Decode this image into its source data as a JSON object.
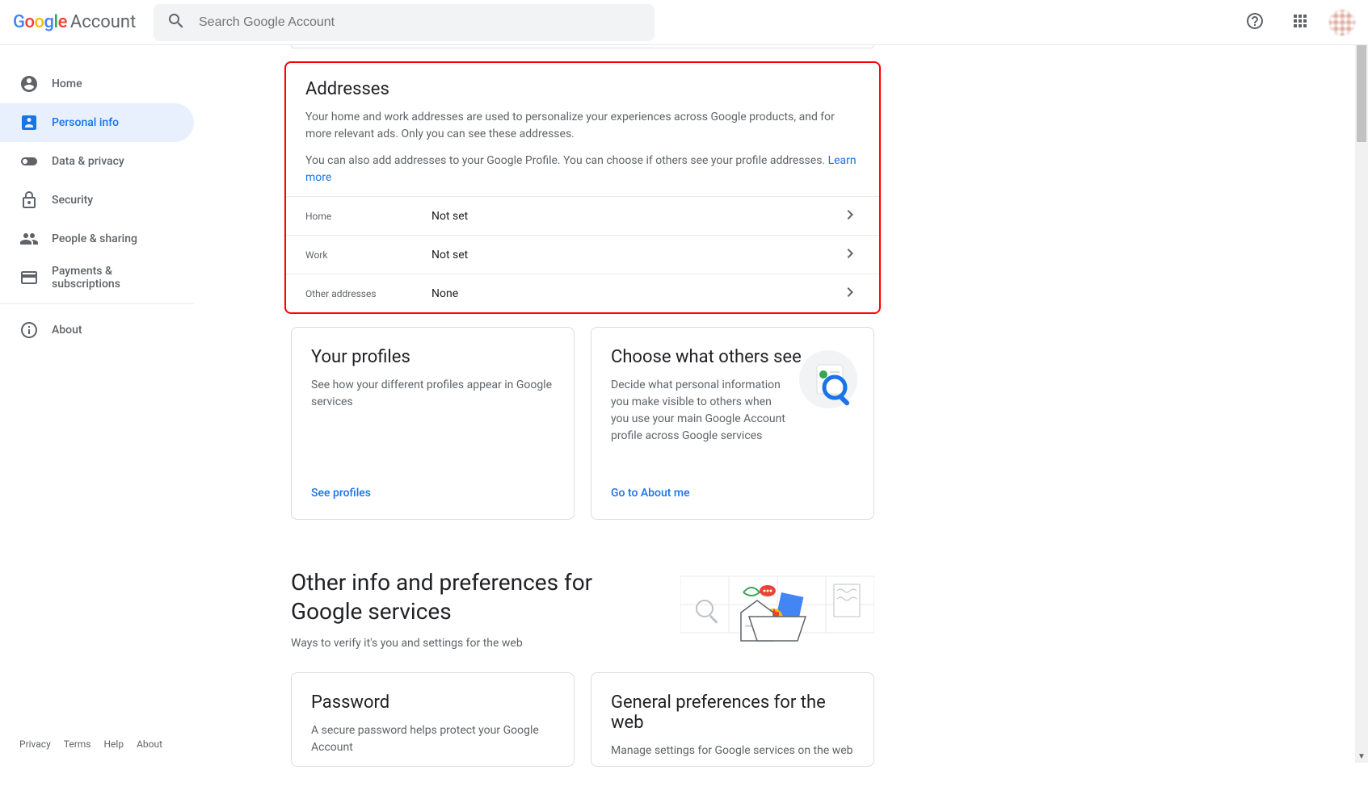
{
  "header": {
    "logo_account_text": "Account",
    "search_placeholder": "Search Google Account"
  },
  "sidebar": {
    "items": [
      {
        "label": "Home"
      },
      {
        "label": "Personal info"
      },
      {
        "label": "Data & privacy"
      },
      {
        "label": "Security"
      },
      {
        "label": "People & sharing"
      },
      {
        "label": "Payments & subscriptions"
      }
    ],
    "about_label": "About",
    "footer": {
      "privacy": "Privacy",
      "terms": "Terms",
      "help": "Help",
      "about": "About"
    }
  },
  "addresses": {
    "title": "Addresses",
    "desc1": "Your home and work addresses are used to personalize your experiences across Google products, and for more relevant ads. Only you can see these addresses.",
    "desc2_a": "You can also add addresses to your Google Profile. You can choose if others see your profile addresses. ",
    "learn_more": "Learn more",
    "rows": [
      {
        "label": "Home",
        "value": "Not set"
      },
      {
        "label": "Work",
        "value": "Not set"
      },
      {
        "label": "Other addresses",
        "value": "None"
      }
    ]
  },
  "profiles_card": {
    "title": "Your profiles",
    "desc": "See how your different profiles appear in Google services",
    "link": "See profiles"
  },
  "others_see_card": {
    "title": "Choose what others see",
    "desc": "Decide what personal information you make visible to others when you use your main Google Account profile across Google services",
    "link": "Go to About me"
  },
  "other_info": {
    "title": "Other info and preferences for Google services",
    "sub": "Ways to verify it's you and settings for the web"
  },
  "password_card": {
    "title": "Password",
    "desc": "A secure password helps protect your Google Account"
  },
  "general_prefs_card": {
    "title": "General preferences for the web",
    "desc": "Manage settings for Google services on the web"
  }
}
